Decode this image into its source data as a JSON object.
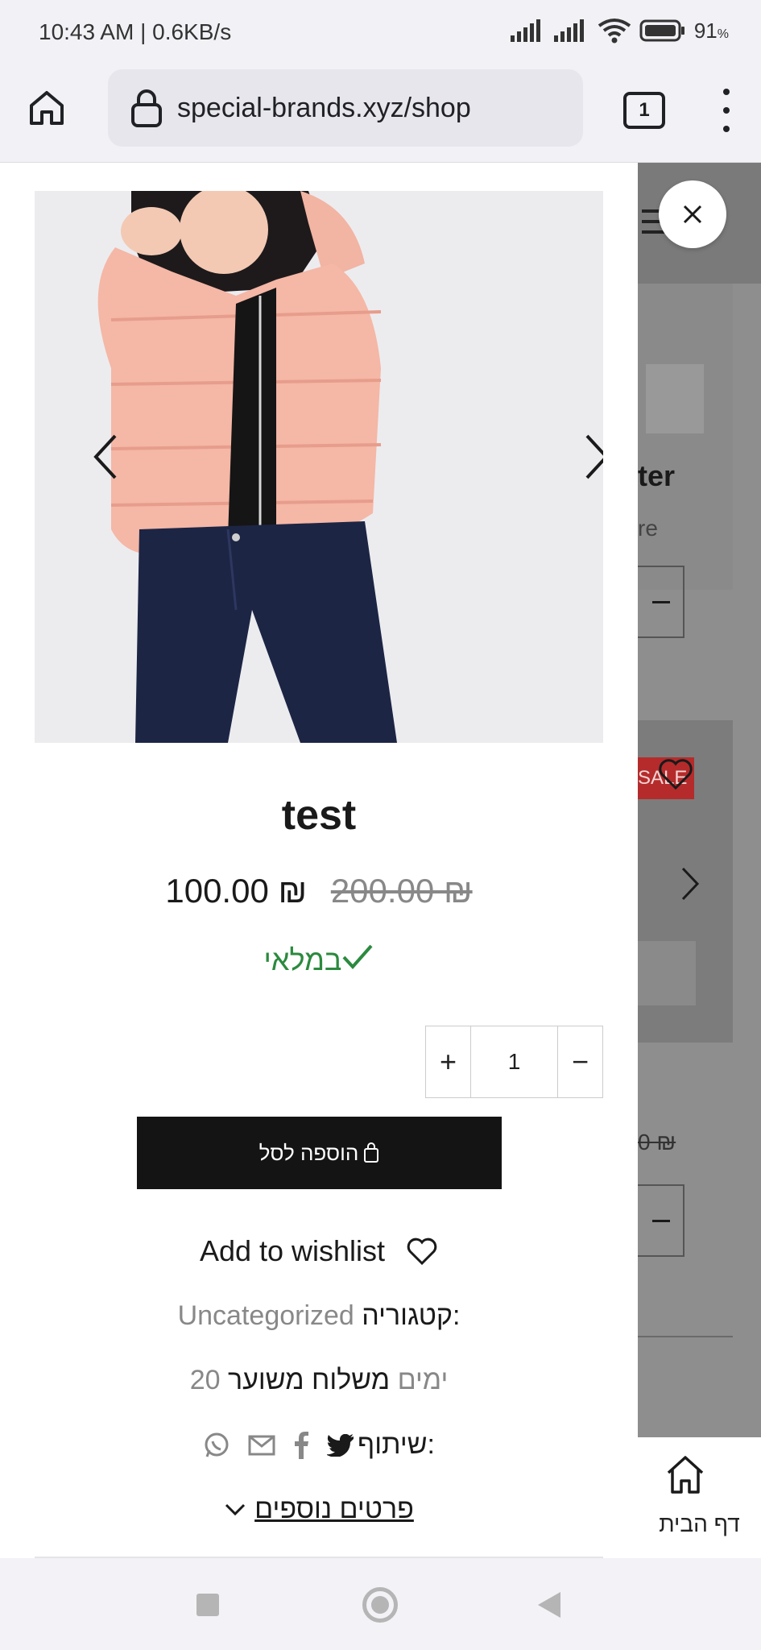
{
  "status_bar": {
    "time": "10:43 AM | 0.6KB/s",
    "battery": "91",
    "battery_unit": "%"
  },
  "browser": {
    "url": "special-brands.xyz/shop",
    "tab_count": "1"
  },
  "product": {
    "title": "test",
    "sale_price": "100.00 ₪",
    "regular_price": "200.00 ₪",
    "stock_status": "במלאי",
    "quantity": "1",
    "add_to_cart_label": "הוספה לסל",
    "wishlist_label": "Add to wishlist",
    "category_label": "קטגוריה:",
    "category_value": "Uncategorized",
    "shipping_label": "משלוח משוער",
    "shipping_value": "20 ימים",
    "share_label": "שיתוף:",
    "more_details_label": "פרטים נוספים"
  },
  "background_page": {
    "product_title_fragment": "ter",
    "product_sub_fragment": "re",
    "sale_badge": "SALE",
    "price_fragment": "0 ₪",
    "home_nav_label": "דף הבית"
  },
  "colors": {
    "in_stock": "#2b8a3e",
    "sale_badge": "#b52b2b",
    "cart_button": "#141414"
  }
}
